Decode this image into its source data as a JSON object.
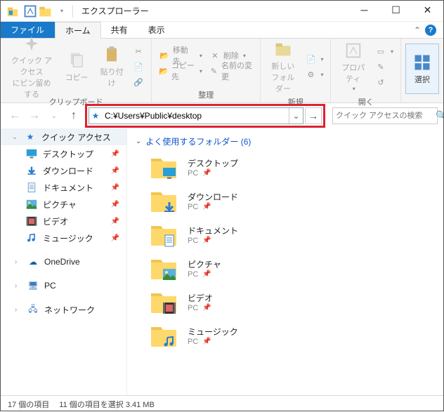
{
  "window": {
    "title": "エクスプローラー"
  },
  "tabs": {
    "file": "ファイル",
    "home": "ホーム",
    "share": "共有",
    "view": "表示"
  },
  "ribbon": {
    "clipboard": {
      "pin": "クイック アクセス\nにピン留めする",
      "copy": "コピー",
      "paste": "貼り付け",
      "label": "クリップボード"
    },
    "organize": {
      "moveto": "移動先",
      "copyto": "コピー先",
      "delete": "削除",
      "rename": "名前の変更",
      "label": "整理"
    },
    "new": {
      "newfolder": "新しい\nフォルダー",
      "label": "新規"
    },
    "open": {
      "properties": "プロパティ",
      "label": "開く"
    },
    "select": {
      "select": "選択",
      "label": ""
    }
  },
  "address": {
    "path": "C:¥Users¥Public¥desktop"
  },
  "search": {
    "placeholder": "クイック アクセスの検索"
  },
  "sidebar": {
    "quickaccess": "クイック アクセス",
    "items": [
      {
        "label": "デスクトップ",
        "icon": "desktop"
      },
      {
        "label": "ダウンロード",
        "icon": "download"
      },
      {
        "label": "ドキュメント",
        "icon": "document"
      },
      {
        "label": "ピクチャ",
        "icon": "picture"
      },
      {
        "label": "ビデオ",
        "icon": "video"
      },
      {
        "label": "ミュージック",
        "icon": "music"
      }
    ],
    "onedrive": "OneDrive",
    "pc": "PC",
    "network": "ネットワーク"
  },
  "content": {
    "section": "よく使用するフォルダー (6)",
    "folders": [
      {
        "name": "デスクトップ",
        "loc": "PC",
        "overlay": "desktop"
      },
      {
        "name": "ダウンロード",
        "loc": "PC",
        "overlay": "download"
      },
      {
        "name": "ドキュメント",
        "loc": "PC",
        "overlay": "document"
      },
      {
        "name": "ピクチャ",
        "loc": "PC",
        "overlay": "picture"
      },
      {
        "name": "ビデオ",
        "loc": "PC",
        "overlay": "video"
      },
      {
        "name": "ミュージック",
        "loc": "PC",
        "overlay": "music"
      }
    ]
  },
  "status": {
    "count": "17 個の項目",
    "selection": "11 個の項目を選択 3.41 MB"
  }
}
